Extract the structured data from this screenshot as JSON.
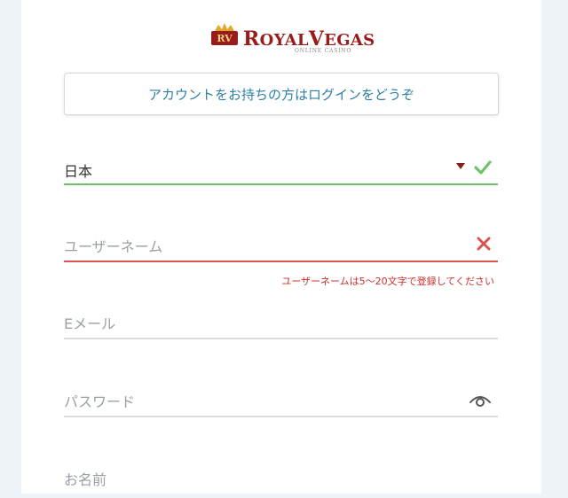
{
  "logo": {
    "badge_letters": "RV",
    "brand_first": "R",
    "brand_rest1": "OYAL",
    "brand_second": "V",
    "brand_rest2": "EGAS",
    "subtitle": "ONLINE CASINO"
  },
  "login_button": {
    "label": "アカウントをお持ちの方はログインをどうぞ"
  },
  "form": {
    "country": {
      "value": "日本",
      "state": "valid"
    },
    "username": {
      "placeholder": "ユーザーネーム",
      "state": "error",
      "error": "ユーザーネームは5〜20文字で登録してください"
    },
    "email": {
      "placeholder": "Eメール"
    },
    "password": {
      "placeholder": "パスワード"
    },
    "name": {
      "placeholder": "お名前"
    }
  },
  "colors": {
    "accent": "#2d7fa8",
    "valid": "#6cc36c",
    "error": "#d9534f",
    "brand": "#9a1b1b"
  },
  "icons": [
    "crown-icon",
    "dropdown-arrow-icon",
    "check-icon",
    "close-icon",
    "eye-icon"
  ]
}
